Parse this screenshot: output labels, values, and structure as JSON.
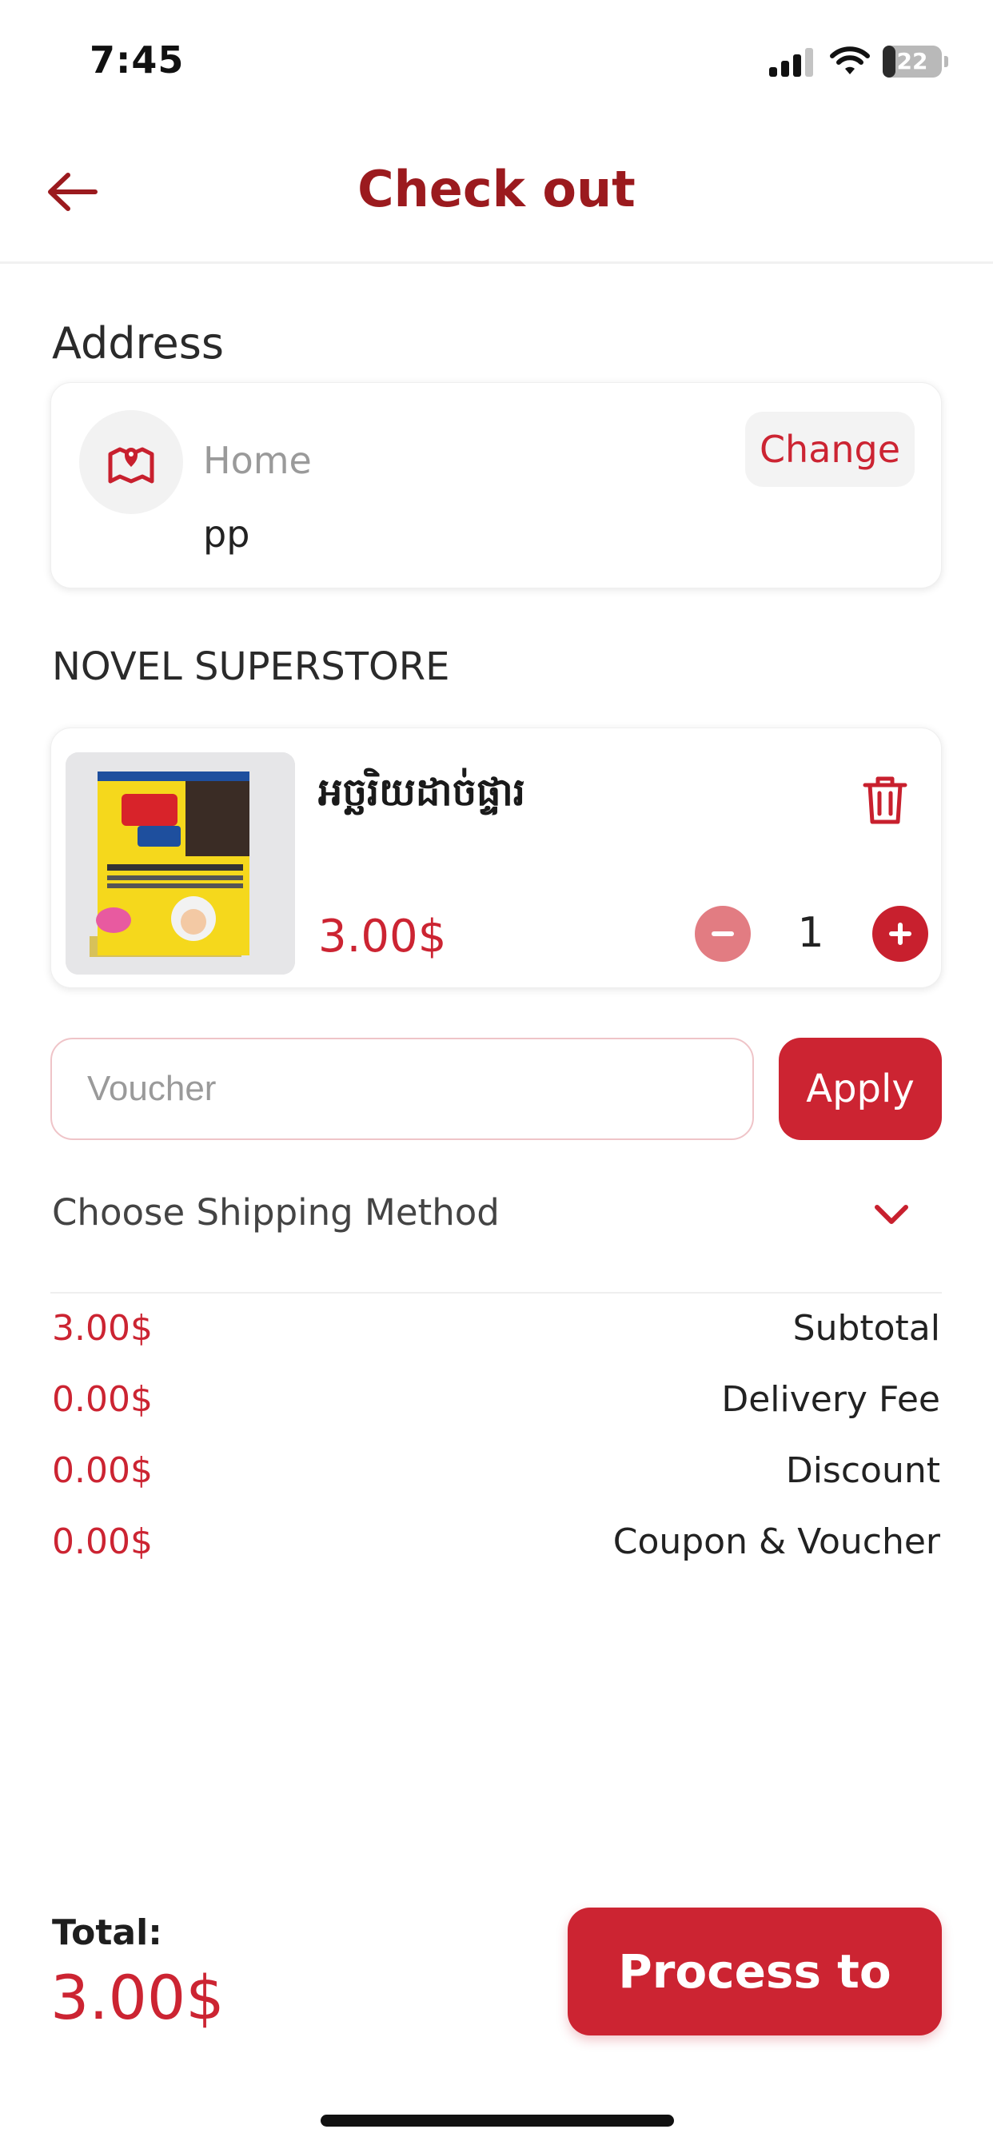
{
  "status_bar": {
    "time": "7:45",
    "battery": "22",
    "battery_level": 0.22,
    "signal_bars": 3,
    "icons": [
      "signal-icon",
      "wifi-icon",
      "battery-icon"
    ]
  },
  "header": {
    "title": "Check out",
    "back_icon": "arrow-left-icon"
  },
  "address": {
    "section_label": "Address",
    "title": "Home",
    "line": "pp",
    "change_label": "Change",
    "icon": "map-pin-icon"
  },
  "store": {
    "name": "NOVEL SUPERSTORE"
  },
  "cart_item": {
    "name": "អច្ឆរិយដាច់ផ្ទារ",
    "price": "3.00$",
    "quantity": "1",
    "thumbnail_icon": "book-cover-image",
    "delete_icon": "trash-icon",
    "minus_icon": "minus-icon",
    "plus_icon": "plus-icon"
  },
  "voucher": {
    "placeholder": "Voucher",
    "value": "",
    "apply_label": "Apply"
  },
  "shipping": {
    "label": "Choose Shipping Method",
    "icon": "chevron-down-icon"
  },
  "summary": [
    {
      "label": "Subtotal",
      "value": "3.00$"
    },
    {
      "label": "Delivery Fee",
      "value": "0.00$"
    },
    {
      "label": "Discount",
      "value": "0.00$"
    },
    {
      "label": "Coupon & Voucher",
      "value": "0.00$"
    }
  ],
  "footer": {
    "total_label": "Total:",
    "total_value": "3.00$",
    "pay_label": "Process to pay"
  },
  "colors": {
    "accent": "#cc2432",
    "title": "#9b1a1e",
    "muted": "#9a9a9a"
  }
}
